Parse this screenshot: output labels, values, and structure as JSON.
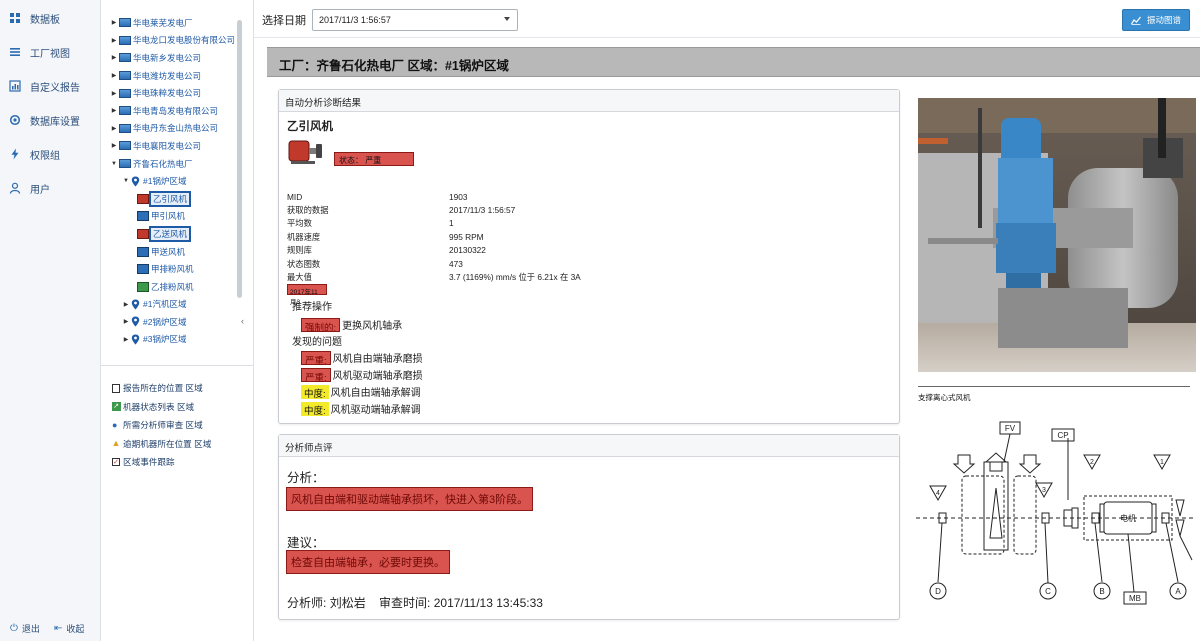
{
  "nav": {
    "items": [
      {
        "label": "数据板",
        "icon": "grid-icon"
      },
      {
        "label": "工厂视图",
        "icon": "list-icon"
      },
      {
        "label": "自定义报告",
        "icon": "bar-chart-icon"
      },
      {
        "label": "数据库设置",
        "icon": "settings-icon"
      },
      {
        "label": "权限组",
        "icon": "bolt-icon"
      },
      {
        "label": "用户",
        "icon": "user-icon"
      }
    ],
    "logout": "退出",
    "collapse": "收起"
  },
  "tree": {
    "nodes": [
      {
        "label": "华电莱芜发电厂",
        "level": 0,
        "expanded": false
      },
      {
        "label": "华电龙口发电股份有限公司",
        "level": 0,
        "expanded": false
      },
      {
        "label": "华电新乡发电公司",
        "level": 0,
        "expanded": false
      },
      {
        "label": "华电潍坊发电公司",
        "level": 0,
        "expanded": false
      },
      {
        "label": "华电珠粹发电公司",
        "level": 0,
        "expanded": false
      },
      {
        "label": "华电青岛发电有限公司",
        "level": 0,
        "expanded": false
      },
      {
        "label": "华电丹东金山热电公司",
        "level": 0,
        "expanded": false
      },
      {
        "label": "华电襄阳发电公司",
        "level": 0,
        "expanded": false
      },
      {
        "label": "齐鲁石化热电厂",
        "level": 0,
        "expanded": true
      },
      {
        "label": "#1锅炉区域",
        "level": 1,
        "expanded": true,
        "pin": true
      },
      {
        "label": "乙引风机",
        "level": 2,
        "fan": "red",
        "selected": true
      },
      {
        "label": "甲引风机",
        "level": 2,
        "fan": "blue"
      },
      {
        "label": "乙送风机",
        "level": 2,
        "fan": "red",
        "selected": true
      },
      {
        "label": "甲送风机",
        "level": 2,
        "fan": "blue"
      },
      {
        "label": "甲排粉风机",
        "level": 2,
        "fan": "blue"
      },
      {
        "label": "乙排粉风机",
        "level": 2,
        "fan": "green"
      },
      {
        "label": "#1汽机区域",
        "level": 1,
        "expanded": false,
        "pin": true
      },
      {
        "label": "#2锅炉区域",
        "level": 1,
        "expanded": false,
        "pin": true
      },
      {
        "label": "#3锅炉区域",
        "level": 1,
        "expanded": false,
        "pin": true
      }
    ],
    "links": [
      {
        "label": "报告所在的位置 区域",
        "icon": "report-icon"
      },
      {
        "label": "机器状态列表 区域",
        "icon": "machine-status-icon"
      },
      {
        "label": "所需分析师审查 区域",
        "icon": "analyst-icon"
      },
      {
        "label": "逾期机器所在位置 区域",
        "icon": "warning-icon"
      },
      {
        "label": "区域事件跟踪",
        "icon": "checkbox-icon"
      }
    ]
  },
  "topbar": {
    "date_label": "选择日期",
    "date_value": "2017/11/3 1:56:57",
    "vibration_button": "振动图谱"
  },
  "banner": "工厂：齐鲁石化热电厂 区域：#1锅炉区域",
  "diag": {
    "title": "自动分析诊断结果",
    "machine": "乙引风机",
    "status": "状态： 严重",
    "fields": [
      {
        "k": "MID",
        "v": "1903"
      },
      {
        "k": "获取的数据",
        "v": "2017/11/3 1:56:57"
      },
      {
        "k": "平均数",
        "v": "1"
      },
      {
        "k": "机器速度",
        "v": "995 RPM"
      },
      {
        "k": "规则库",
        "v": "20130322"
      },
      {
        "k": "状态图数",
        "v": "473"
      },
      {
        "k": "最大值",
        "v": "3.7 (1169%) mm/s 位于 6.21x 在 3A"
      }
    ],
    "date_tag": "2017年11月3",
    "recommend_head": "推荐操作",
    "recommend_tag": "强制的:",
    "recommend_text": "更换风机轴承",
    "problems_head": "发现的问题",
    "problems": [
      {
        "severity": "严重:",
        "level": "red",
        "text": "风机自由端轴承磨损"
      },
      {
        "severity": "严重:",
        "level": "red",
        "text": "风机驱动端轴承磨损"
      },
      {
        "severity": "中度:",
        "level": "yellow",
        "text": "风机自由端轴承解调"
      },
      {
        "severity": "中度:",
        "level": "yellow",
        "text": "风机驱动端轴承解调"
      }
    ]
  },
  "analysis": {
    "title": "分析师点评",
    "analysis_head": "分析：",
    "analysis_text": "风机自由端和驱动端轴承损坏，快进入第3阶段。",
    "suggest_head": "建议：",
    "suggest_text": "检查自由端轴承，必要时更换。",
    "analyst_label": "分析师:",
    "analyst_name": "刘松岩",
    "review_label": "审查时间:",
    "review_time": "2017/11/13 13:45:33"
  },
  "photo": {
    "caption": "支撑离心式风机"
  },
  "diagram": {
    "labels": {
      "fv": "FV",
      "cp": "CP",
      "motor": "电机",
      "mb": "MB",
      "a": "A",
      "b": "B",
      "c": "C",
      "d": "D",
      "n1": "1",
      "n2": "2",
      "n3": "3",
      "n4": "4"
    }
  },
  "colors": {
    "severe": "#d9534f",
    "moderate": "#f3ea2a",
    "accent": "#3a8fd2",
    "banner": "#b8b8b8"
  }
}
